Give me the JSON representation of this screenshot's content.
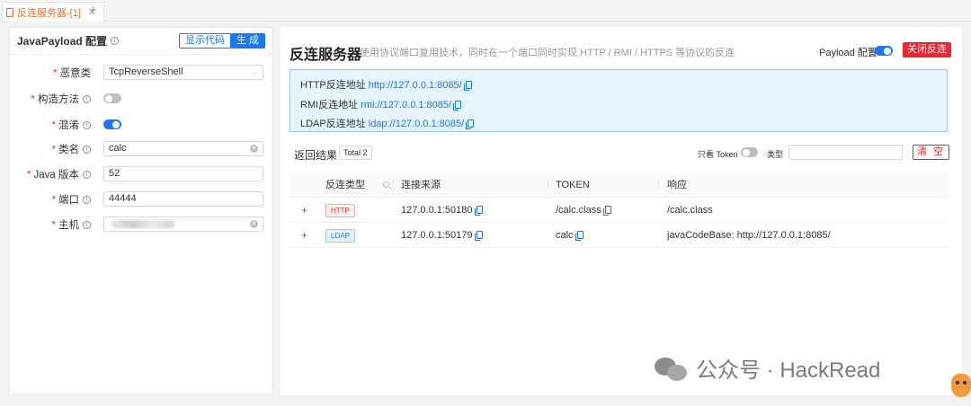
{
  "tab": {
    "label": "反连服务器-[1]",
    "close": "✕",
    "add": "+"
  },
  "left": {
    "title": "JavaPayload 配置",
    "show_code_label": "显示代码",
    "generate_label": "生 成",
    "fields": [
      {
        "label": "恶意类",
        "required": true,
        "type": "select",
        "value": "TcpReverseShell"
      },
      {
        "label": "构造方法",
        "required": true,
        "type": "switch",
        "value": false
      },
      {
        "label": "混淆",
        "required": true,
        "type": "switch",
        "value": true
      },
      {
        "label": "类名",
        "required": true,
        "type": "input",
        "value": "calc"
      },
      {
        "label": "Java 版本",
        "required": true,
        "type": "input",
        "value": "52"
      },
      {
        "label": "端口",
        "required": true,
        "type": "input",
        "value": "44444"
      },
      {
        "label": "主机",
        "required": true,
        "type": "input-redacted",
        "value": ""
      }
    ]
  },
  "right": {
    "title": "反连服务器",
    "description": "使用协议端口复用技术，同时在一个端口同时实现 HTTP / RMI / HTTPS 等协议的反连",
    "payload_label": "Payload 配置:",
    "payload_enabled": true,
    "close_label": "关闭反连",
    "addresses": [
      {
        "label": "HTTP反连地址",
        "url": "http://127.0.0.1:8085/"
      },
      {
        "label": "RMI反连地址",
        "url": "rmi://127.0.0.1:8085/"
      },
      {
        "label": "LDAP反连地址",
        "url": "ldap://127.0.0.1:8085/"
      }
    ],
    "result_label": "返回结果",
    "total_label": "Total 2",
    "only_token_label": "只看 Token",
    "only_token_enabled": false,
    "type_label": "类型",
    "type_value": "",
    "clear_label": "清 空",
    "columns": [
      "反连类型",
      "连接来源",
      "TOKEN",
      "响应"
    ],
    "rows": [
      {
        "expand": "+",
        "type": "HTTP",
        "source": "127.0.0.1:50180",
        "token": "/calc.class",
        "response": "/calc.class"
      },
      {
        "expand": "+",
        "type": "LDAP",
        "source": "127.0.0.1:50179",
        "token": "calc",
        "response": "javaCodeBase: http://127.0.0.1:8085/"
      }
    ]
  },
  "watermark": {
    "text": "公众号 · HackRead"
  },
  "colors": {
    "primary": "#1677ff",
    "danger": "#f5222d",
    "tab_accent": "#e8702a",
    "info_bg": "#e6f4ff"
  }
}
